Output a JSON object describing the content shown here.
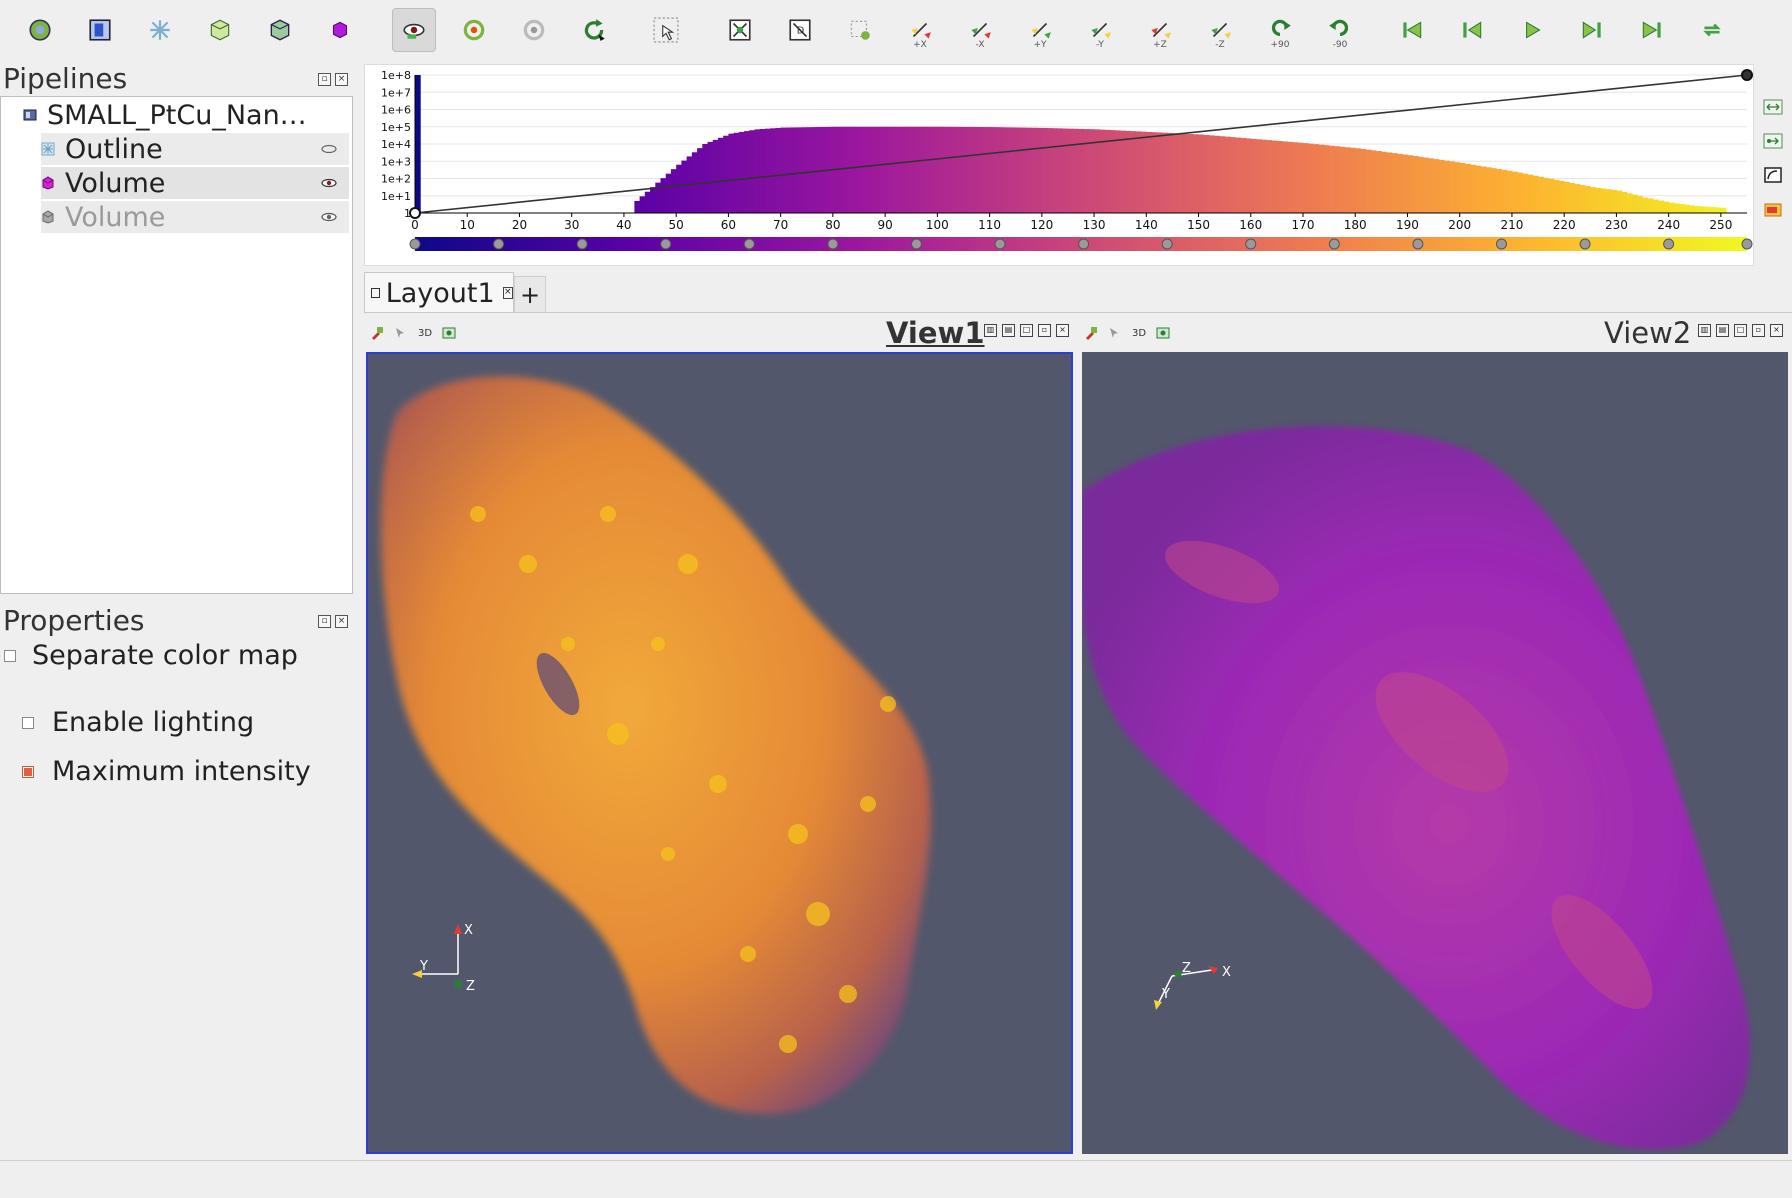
{
  "toolbar": {
    "buttons": [
      {
        "name": "open-data-icon"
      },
      {
        "name": "outline-representation-icon"
      },
      {
        "name": "surface-icon"
      },
      {
        "name": "cube-green-icon"
      },
      {
        "name": "wireframe-cube-icon"
      },
      {
        "name": "volume-cube-icon"
      },
      {
        "name": "interact-eye-icon"
      },
      {
        "name": "reset-camera-icon"
      },
      {
        "name": "rotate-center-icon"
      },
      {
        "name": "refresh-icon"
      },
      {
        "name": "pointer-select-icon"
      },
      {
        "name": "zoom-fit-icon"
      },
      {
        "name": "zoom-data-icon"
      },
      {
        "name": "select-points-icon"
      },
      {
        "name": "view-plus-x-icon",
        "label": "+X"
      },
      {
        "name": "view-minus-x-icon",
        "label": "-X"
      },
      {
        "name": "view-plus-y-icon",
        "label": "+Y"
      },
      {
        "name": "view-minus-y-icon",
        "label": "-Y"
      },
      {
        "name": "view-plus-z-icon",
        "label": "+Z"
      },
      {
        "name": "view-minus-z-icon",
        "label": "-Z"
      },
      {
        "name": "rotate-plus-90-icon",
        "label": "+90"
      },
      {
        "name": "rotate-minus-90-icon",
        "label": "-90"
      },
      {
        "name": "first-frame-icon"
      },
      {
        "name": "previous-frame-icon"
      },
      {
        "name": "play-icon"
      },
      {
        "name": "next-frame-icon"
      },
      {
        "name": "last-frame-icon"
      },
      {
        "name": "loop-icon"
      }
    ]
  },
  "pipelines": {
    "title": "Pipelines",
    "items": [
      {
        "label": "SMALL_PtCu_Nan…",
        "icon": "data-source-icon",
        "visibility": "none"
      },
      {
        "label": "Outline",
        "icon": "outline-icon",
        "visibility": "hidden"
      },
      {
        "label": "Volume",
        "icon": "volume-magenta-icon",
        "visibility": "visible"
      },
      {
        "label": "Volume",
        "icon": "volume-grey-icon",
        "visibility": "visible"
      }
    ]
  },
  "properties": {
    "title": "Properties",
    "separate_color_map": {
      "label": "Separate color map",
      "checked": false
    },
    "enable_lighting": {
      "label": "Enable lighting",
      "checked": false
    },
    "maximum_intensity": {
      "label": "Maximum intensity",
      "checked": true
    }
  },
  "layout": {
    "tab_label": "Layout1",
    "add_tab_label": "+",
    "views": [
      {
        "title": "View1",
        "toolbar_text": "3D",
        "active": true,
        "axes": {
          "a": "X",
          "b": "Y",
          "c": "Z"
        }
      },
      {
        "title": "View2",
        "toolbar_text": "3D",
        "active": false,
        "axes": {
          "a": "X",
          "b": "Y",
          "c": "Z"
        }
      }
    ]
  },
  "colors": {
    "viewport_bg": "#52576b",
    "active_border": "#2b3fd6",
    "colormap": [
      "#0d0887",
      "#5c01a6",
      "#9c179e",
      "#cc4778",
      "#ed7953",
      "#fdb42f",
      "#f0f921"
    ]
  },
  "chart_data": {
    "type": "bar",
    "title": "",
    "xlabel": "",
    "ylabel": "",
    "y_scale": "log",
    "xlim": [
      0,
      256
    ],
    "ylim": [
      1,
      100000000
    ],
    "x_ticks": [
      "0",
      "10",
      "20",
      "30",
      "40",
      "50",
      "60",
      "70",
      "80",
      "90",
      "100",
      "110",
      "120",
      "130",
      "140",
      "150",
      "160",
      "170",
      "180",
      "190",
      "200",
      "210",
      "220",
      "230",
      "240",
      "250"
    ],
    "y_ticks": [
      "1",
      "1e+1",
      "1e+2",
      "1e+3",
      "1e+4",
      "1e+5",
      "1e+6",
      "1e+7",
      "1e+8"
    ],
    "histogram": {
      "x": [
        0,
        1,
        42,
        45,
        50,
        55,
        60,
        65,
        70,
        80,
        90,
        100,
        110,
        120,
        130,
        140,
        150,
        160,
        170,
        180,
        190,
        200,
        210,
        220,
        225,
        230,
        235,
        240,
        245,
        250
      ],
      "counts_log10": [
        0,
        8,
        0.7,
        1.5,
        2.8,
        4.0,
        4.6,
        4.85,
        4.95,
        5.0,
        5.0,
        5.0,
        4.98,
        4.93,
        4.85,
        4.7,
        4.55,
        4.3,
        4.05,
        3.75,
        3.35,
        2.9,
        2.4,
        1.8,
        1.5,
        1.3,
        0.9,
        0.6,
        0.4,
        0.3
      ]
    },
    "opacity_line": {
      "x": [
        0,
        255
      ],
      "y_log10": [
        0,
        8
      ]
    },
    "colormap_nodes": [
      0,
      16,
      32,
      48,
      64,
      80,
      96,
      112,
      128,
      144,
      160,
      176,
      192,
      208,
      224,
      240,
      255
    ]
  }
}
